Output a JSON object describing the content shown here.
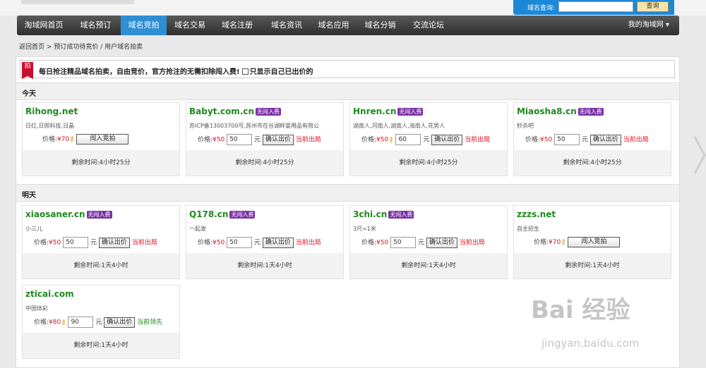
{
  "search": {
    "label": "域名查询:",
    "value": "",
    "button": "查询"
  },
  "nav": {
    "items": [
      "淘域网首页",
      "域名预订",
      "域名竞拍",
      "域名交易",
      "域名注册",
      "域名资讯",
      "域名应用",
      "域名分销",
      "交流论坛"
    ],
    "active_index": 2,
    "account": "我的淘域网"
  },
  "breadcrumb": {
    "back": "返回首页",
    "path": "预订成功待竞价 / 用户域名拍卖"
  },
  "notice": {
    "badge": "拍",
    "text": "每日抢注精品域名拍卖，自由竞价，官方抢注的无需扣除闯入费!",
    "checkbox_label": "只显示自己已出价的"
  },
  "sections": [
    {
      "title": "今天",
      "cards": [
        {
          "domain": "Rihong.net",
          "tag": "",
          "desc": "日红,日照科技,日晶",
          "price_label": "价格:",
          "price": "¥70",
          "key": true,
          "mode": "enter",
          "button": "闯入竞拍",
          "remaining": "剩余时间:4小时25分"
        },
        {
          "domain": "Babyt.com.cn",
          "tag": "无闯入费",
          "desc": "苏ICP备13003700号,苏州市在谷湖畔婴用品有限公",
          "price_label": "价格:",
          "price": "¥50",
          "key": false,
          "mode": "bid",
          "input": "50",
          "unit": "元",
          "button": "确认出价",
          "status": "当前出局",
          "remaining": "剩余时间:4小时25分"
        },
        {
          "domain": "Hnren.cn",
          "tag": "无闯入费",
          "desc": "湖南人,河南人,湖南人,海南人,花男人",
          "price_label": "价格:",
          "price": "¥50",
          "key": true,
          "mode": "bid",
          "input": "60",
          "unit": "元",
          "button": "确认出价",
          "status": "当前出局",
          "remaining": "剩余时间:4小时25分"
        },
        {
          "domain": "Miaosha8.cn",
          "tag": "无闯入费",
          "desc": "秒杀吧",
          "price_label": "价格:",
          "price": "¥50",
          "key": false,
          "mode": "bid",
          "input": "50",
          "unit": "元",
          "button": "确认出价",
          "status": "当前出局",
          "remaining": "剩余时间:4小时25分"
        }
      ]
    },
    {
      "title": "明天",
      "cards": [
        {
          "domain": "xiaosaner.cn",
          "tag": "无闯入费",
          "desc": "小三儿",
          "price_label": "价格:",
          "price": "¥50",
          "key": false,
          "mode": "bid",
          "input": "50",
          "unit": "元",
          "button": "确认出价",
          "status": "当前出局",
          "remaining": "剩余时间:1天4小时"
        },
        {
          "domain": "Q178.cn",
          "tag": "无闯入费",
          "desc": "一起发",
          "price_label": "价格:",
          "price": "¥50",
          "key": false,
          "mode": "bid",
          "input": "50",
          "unit": "元",
          "button": "确认出价",
          "status": "当前出局",
          "remaining": "剩余时间:1天4小时"
        },
        {
          "domain": "3chi.cn",
          "tag": "无闯入费",
          "desc": "3尺=1米",
          "price_label": "价格:",
          "price": "¥50",
          "key": false,
          "mode": "bid",
          "input": "50",
          "unit": "元",
          "button": "确认出价",
          "status": "当前出局",
          "remaining": "剩余时间:1天4小时"
        },
        {
          "domain": "zzzs.net",
          "tag": "",
          "desc": "自主招生",
          "price_label": "价格:",
          "price": "¥70",
          "key": true,
          "mode": "enter",
          "button": "闯入竞拍",
          "remaining": "剩余时间:1天4小时"
        },
        {
          "domain": "zticai.com",
          "tag": "",
          "desc": "中国体彩",
          "price_label": "价格:",
          "price": "¥80",
          "key": true,
          "mode": "bid",
          "input": "90",
          "unit": "元",
          "button": "确认出价",
          "status": "当前领先",
          "status_color": "#1e8a1e",
          "remaining": "剩余时间:1天4小时"
        }
      ]
    }
  ],
  "watermark": {
    "brand": "Bai  经验",
    "url": "jingyan.baidu.com"
  }
}
